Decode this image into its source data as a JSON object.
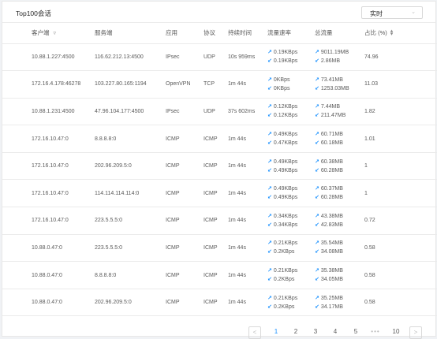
{
  "panel": {
    "title": "Top100会话",
    "time_select": "实时"
  },
  "columns": {
    "client": "客户端",
    "server": "服务端",
    "app": "应用",
    "protocol": "协议",
    "duration": "持续时间",
    "rate": "流量速率",
    "total": "总流量",
    "percent": "占比 (%)"
  },
  "rows": [
    {
      "client": "10.88.1.227:4500",
      "server": "116.62.212.13:4500",
      "app": "IPsec",
      "protocol": "UDP",
      "duration": "10s 959ms",
      "rate_up": "0.19KBps",
      "rate_down": "0.19KBps",
      "total_up": "9011.19MB",
      "total_down": "2.86MB",
      "percent": "74.96"
    },
    {
      "client": "172.16.4.178:46278",
      "server": "103.227.80.165:1194",
      "app": "OpenVPN",
      "protocol": "TCP",
      "duration": "1m 44s",
      "rate_up": "0KBps",
      "rate_down": "0KBps",
      "total_up": "73.41MB",
      "total_down": "1253.03MB",
      "percent": "11.03"
    },
    {
      "client": "10.88.1.231:4500",
      "server": "47.96.104.177:4500",
      "app": "IPsec",
      "protocol": "UDP",
      "duration": "37s 602ms",
      "rate_up": "0.12KBps",
      "rate_down": "0.12KBps",
      "total_up": "7.44MB",
      "total_down": "211.47MB",
      "percent": "1.82"
    },
    {
      "client": "172.16.10.47:0",
      "server": "8.8.8.8:0",
      "app": "ICMP",
      "protocol": "ICMP",
      "duration": "1m 44s",
      "rate_up": "0.49KBps",
      "rate_down": "0.47KBps",
      "total_up": "60.71MB",
      "total_down": "60.18MB",
      "percent": "1.01"
    },
    {
      "client": "172.16.10.47:0",
      "server": "202.96.209.5:0",
      "app": "ICMP",
      "protocol": "ICMP",
      "duration": "1m 44s",
      "rate_up": "0.49KBps",
      "rate_down": "0.49KBps",
      "total_up": "60.38MB",
      "total_down": "60.28MB",
      "percent": "1"
    },
    {
      "client": "172.16.10.47:0",
      "server": "114.114.114.114:0",
      "app": "ICMP",
      "protocol": "ICMP",
      "duration": "1m 44s",
      "rate_up": "0.49KBps",
      "rate_down": "0.49KBps",
      "total_up": "60.37MB",
      "total_down": "60.28MB",
      "percent": "1"
    },
    {
      "client": "172.16.10.47:0",
      "server": "223.5.5.5:0",
      "app": "ICMP",
      "protocol": "ICMP",
      "duration": "1m 44s",
      "rate_up": "0.34KBps",
      "rate_down": "0.34KBps",
      "total_up": "43.38MB",
      "total_down": "42.83MB",
      "percent": "0.72"
    },
    {
      "client": "10.88.0.47:0",
      "server": "223.5.5.5:0",
      "app": "ICMP",
      "protocol": "ICMP",
      "duration": "1m 44s",
      "rate_up": "0.21KBps",
      "rate_down": "0.2KBps",
      "total_up": "35.54MB",
      "total_down": "34.08MB",
      "percent": "0.58"
    },
    {
      "client": "10.88.0.47:0",
      "server": "8.8.8.8:0",
      "app": "ICMP",
      "protocol": "ICMP",
      "duration": "1m 44s",
      "rate_up": "0.21KBps",
      "rate_down": "0.2KBps",
      "total_up": "35.38MB",
      "total_down": "34.05MB",
      "percent": "0.58"
    },
    {
      "client": "10.88.0.47:0",
      "server": "202.96.209.5:0",
      "app": "ICMP",
      "protocol": "ICMP",
      "duration": "1m 44s",
      "rate_up": "0.21KBps",
      "rate_down": "0.2KBps",
      "total_up": "35.25MB",
      "total_down": "34.17MB",
      "percent": "0.58"
    }
  ],
  "pagination": {
    "prev": "<",
    "next": ">",
    "pages": [
      "1",
      "2",
      "3",
      "4",
      "5"
    ],
    "ellipsis": "•••",
    "last": "10",
    "current": "1"
  },
  "icons": {
    "filter": "filter-icon",
    "sort": "sort-icon",
    "select_chevron": "chevron-down-icon",
    "up_arrow": "arrow-up-right-icon",
    "down_arrow": "arrow-down-left-icon"
  },
  "colors": {
    "accent": "#1890ff"
  }
}
